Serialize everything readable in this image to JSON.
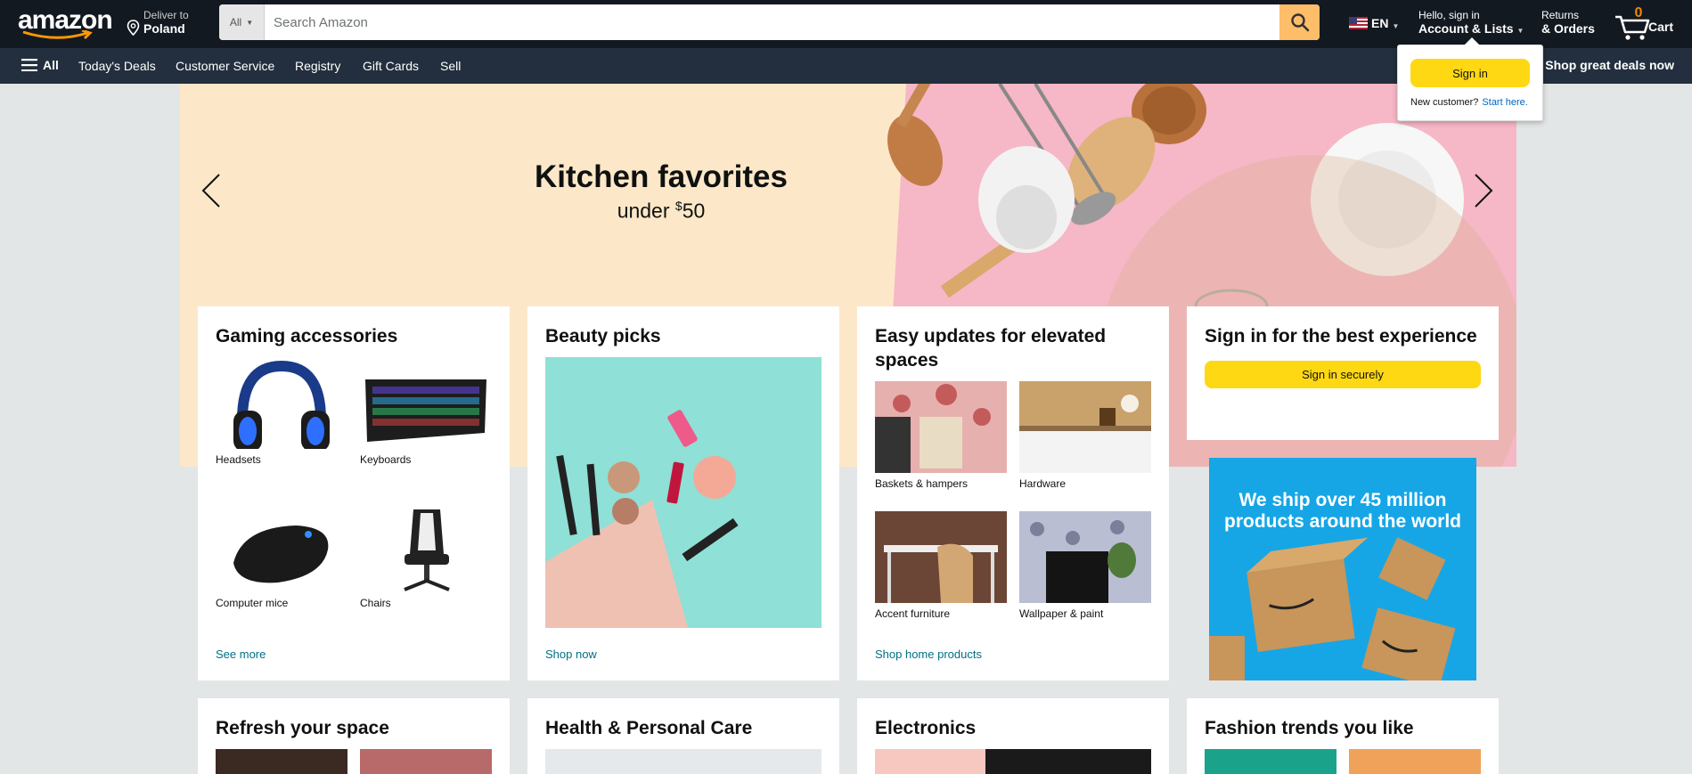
{
  "header": {
    "logo_text": "amazon",
    "deliver_line1": "Deliver to",
    "deliver_line2": "Poland",
    "search_category": "All",
    "search_placeholder": "Search Amazon",
    "language": "EN",
    "account_line1": "Hello, sign in",
    "account_line2": "Account & Lists",
    "returns_line1": "Returns",
    "returns_line2": "& Orders",
    "cart_count": "0",
    "cart_label": "Cart"
  },
  "subnav": {
    "all_label": "All",
    "items": [
      "Today's Deals",
      "Customer Service",
      "Registry",
      "Gift Cards",
      "Sell"
    ],
    "promo": "Shop great deals now"
  },
  "hero": {
    "title": "Kitchen favorites",
    "sub_prefix": "under ",
    "sub_currency": "$",
    "sub_amount": "50"
  },
  "flyout": {
    "button": "Sign in",
    "new_customer": "New customer?",
    "start_here": "Start here."
  },
  "cards": {
    "gaming": {
      "title": "Gaming accessories",
      "tiles": [
        "Headsets",
        "Keyboards",
        "Computer mice",
        "Chairs"
      ],
      "link": "See more"
    },
    "beauty": {
      "title": "Beauty picks",
      "link": "Shop now"
    },
    "home": {
      "title": "Easy updates for elevated spaces",
      "tiles": [
        "Baskets & hampers",
        "Hardware",
        "Accent furniture",
        "Wallpaper & paint"
      ],
      "link": "Shop home products"
    },
    "signin": {
      "title": "Sign in for the best experience",
      "button": "Sign in securely"
    },
    "ship_ad": "We ship over 45 million products around the world"
  },
  "row2": [
    "Refresh your space",
    "Health & Personal Care",
    "Electronics",
    "Fashion trends you like"
  ],
  "colors": {
    "nav_bg": "#131921",
    "subnav_bg": "#232f3e",
    "accent_yellow": "#ffd814",
    "search_button": "#febd69",
    "link": "#007185"
  }
}
